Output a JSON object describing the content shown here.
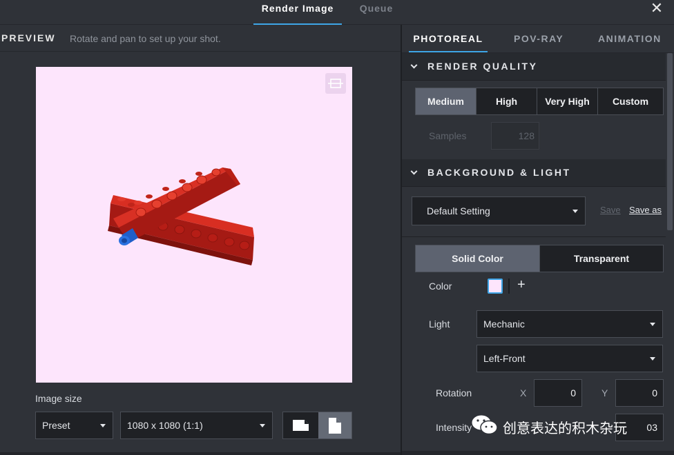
{
  "window": {
    "tabs": [
      {
        "label": "Render Image",
        "active": true
      },
      {
        "label": "Queue",
        "active": false
      }
    ],
    "close_glyph": "✕"
  },
  "preview": {
    "label": "PREVIEW",
    "hint": "Rotate and pan to set up your shot.",
    "background_color": "#fde5fc",
    "toggle_icon": "frame-toggle-icon",
    "image_size": {
      "label": "Image size",
      "preset": "Preset",
      "resolution": "1080 x 1080 (1:1)",
      "orientation_options": [
        "landscape",
        "portrait"
      ],
      "orientation_selected": "portrait"
    }
  },
  "settings": {
    "tabs": [
      {
        "label": "PHOTOREAL",
        "active": true
      },
      {
        "label": "POV-RAY",
        "active": false
      },
      {
        "label": "ANIMATION",
        "active": false
      }
    ],
    "render_quality": {
      "title": "RENDER QUALITY",
      "options": [
        "Medium",
        "High",
        "Very High",
        "Custom"
      ],
      "selected": "Medium",
      "samples_label": "Samples",
      "samples_value": "128"
    },
    "background_light": {
      "title": "BACKGROUND & LIGHT",
      "preset": "Default Setting",
      "save_label": "Save",
      "save_as_label": "Save as",
      "fill_options": [
        "Solid Color",
        "Transparent"
      ],
      "fill_selected": "Solid Color",
      "color_label": "Color",
      "color_value": "#fde5fc",
      "add_glyph": "+",
      "light_label": "Light",
      "light_type": "Mechanic",
      "light_direction": "Left-Front",
      "rotation_label": "Rotation",
      "rotation_x_label": "X",
      "rotation_x": "0",
      "rotation_y_label": "Y",
      "rotation_y": "0",
      "intensity_label": "Intensity",
      "intensity_value": "03"
    }
  },
  "watermark": {
    "text": "创意表达的积木杂玩",
    "icon": "wechat-icon"
  },
  "colors": {
    "accent": "#3ea6e8",
    "brick_red": "#c8241c",
    "pin_blue": "#1f5fc9"
  }
}
